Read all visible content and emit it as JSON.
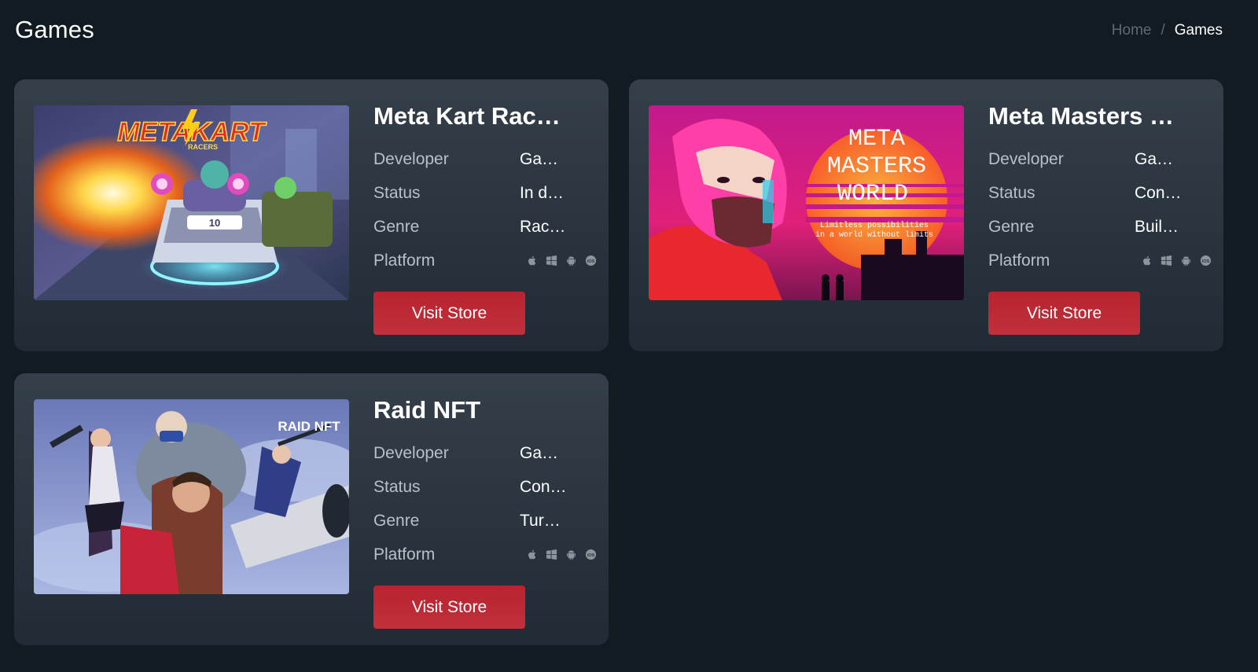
{
  "header": {
    "title": "Games",
    "breadcrumb": {
      "home": "Home",
      "separator": "/",
      "current": "Games"
    }
  },
  "labels": {
    "developer": "Developer",
    "status": "Status",
    "genre": "Genre",
    "platform": "Platform",
    "visit_store": "Visit Store"
  },
  "platform_icons": [
    "apple-icon",
    "windows-icon",
    "android-icon",
    "ios-icon"
  ],
  "colors": {
    "background": "#121a22",
    "card_top": "#343f4a",
    "card_bottom": "#212b35",
    "button": "#bb2a35",
    "muted_text": "#b9c0c7"
  },
  "games": [
    {
      "title": "Meta Kart Rac…",
      "developer": "Ga…",
      "status": "In d…",
      "genre": "Rac…",
      "image_logo": "METAKART",
      "image_logo_sub": "RACERS"
    },
    {
      "title": "Meta Masters …",
      "developer": "Ga…",
      "status": "Con…",
      "genre": "Buil…",
      "image_logo": "META MASTERS WORLD",
      "image_tagline": "Limitless possibilities in a world without limits"
    },
    {
      "title": "Raid NFT",
      "developer": "Ga…",
      "status": "Con…",
      "genre": "Tur…",
      "image_logo": "RAID NFT"
    }
  ]
}
